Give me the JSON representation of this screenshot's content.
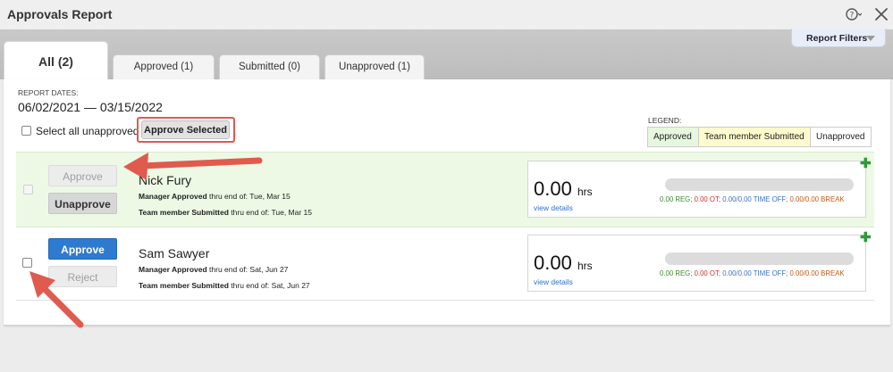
{
  "window": {
    "title": "Approvals Report"
  },
  "icons": {
    "help": "help-dropdown-icon",
    "close": "close-icon",
    "plus": "plus-icon",
    "caret": "caret-down-icon"
  },
  "filters": {
    "label": "Report Filters"
  },
  "tabs": [
    {
      "label": "All (2)",
      "active": true
    },
    {
      "label": "Approved (1)",
      "active": false
    },
    {
      "label": "Submitted (0)",
      "active": false
    },
    {
      "label": "Unapproved (1)",
      "active": false
    }
  ],
  "report": {
    "dates_label": "REPORT DATES:",
    "dates": "06/02/2021 — 03/15/2022"
  },
  "bulk": {
    "select_all_label": "Select all unapproved",
    "approve_selected_label": "Approve Selected"
  },
  "legend": {
    "label": "LEGEND:",
    "approved": "Approved",
    "submitted": "Team member Submitted",
    "unapproved": "Unapproved"
  },
  "rows": [
    {
      "status": "approved",
      "name": "Nick Fury",
      "primary_button": "Approve",
      "secondary_button": "Unapprove",
      "manager_label": "Manager Approved",
      "manager_rest": " thru end of: Tue, Mar 15",
      "member_label": "Team member Submitted",
      "member_rest": " thru end of: Tue, Mar 15",
      "hours": "0.00",
      "hours_unit": "hrs",
      "view_details": "view details",
      "reg": "0.00 REG;",
      "ot": "0.00 OT;",
      "time_off": "0.00/0.00 TIME OFF;",
      "break": "0.00/0.00 BREAK"
    },
    {
      "status": "unapproved",
      "name": "Sam Sawyer",
      "primary_button": "Approve",
      "secondary_button": "Reject",
      "manager_label": "Manager Approved",
      "manager_rest": " thru end of: Sat, Jun 27",
      "member_label": "Team member Submitted",
      "member_rest": " thru end of: Sat, Jun 27",
      "hours": "0.00",
      "hours_unit": "hrs",
      "view_details": "view details",
      "reg": "0.00 REG;",
      "ot": "0.00 OT;",
      "time_off": "0.00/0.00 TIME OFF;",
      "break": "0.00/0.00 BREAK"
    }
  ],
  "colors": {
    "approved_bg": "#edf9e4",
    "submitted_bg": "#fdfacd",
    "approve_blue": "#2f7ad1",
    "annotation_red": "#e05a4e",
    "plus_green": "#2e9a3a"
  }
}
